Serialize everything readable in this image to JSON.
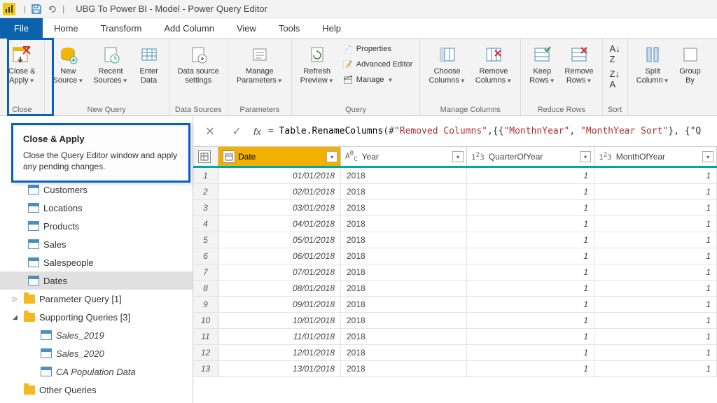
{
  "title": "UBG To Power BI - Model - Power Query Editor",
  "menus": [
    "File",
    "Home",
    "Transform",
    "Add Column",
    "View",
    "Tools",
    "Help"
  ],
  "ribbon": {
    "close": {
      "label": "Close &\nApply",
      "group": "Close"
    },
    "new_query": {
      "new_source": "New\nSource",
      "recent": "Recent\nSources",
      "enter": "Enter\nData",
      "group": "New Query"
    },
    "data_sources": {
      "settings": "Data source\nsettings",
      "group": "Data Sources"
    },
    "parameters": {
      "manage": "Manage\nParameters",
      "group": "Parameters"
    },
    "query": {
      "refresh": "Refresh\nPreview",
      "properties": "Properties",
      "advanced": "Advanced Editor",
      "manage": "Manage",
      "group": "Query"
    },
    "manage_cols": {
      "choose": "Choose\nColumns",
      "remove": "Remove\nColumns",
      "group": "Manage Columns"
    },
    "reduce_rows": {
      "keep": "Keep\nRows",
      "remove": "Remove\nRows",
      "group": "Reduce Rows"
    },
    "sort": {
      "group": "Sort"
    },
    "transform": {
      "split": "Split\nColumn",
      "group": "Group\nBy"
    }
  },
  "tooltip": {
    "title": "Close & Apply",
    "body": "Close the Query Editor window and apply any pending changes."
  },
  "queries": {
    "tables": [
      "Customers",
      "Locations",
      "Products",
      "Sales",
      "Salespeople",
      "Dates"
    ],
    "selected": "Dates",
    "folders": [
      {
        "name": "Parameter Query [1]",
        "open": false
      },
      {
        "name": "Supporting Queries [3]",
        "open": true,
        "items": [
          "Sales_2019",
          "Sales_2020",
          "CA Population Data"
        ]
      }
    ],
    "other": "Other Queries"
  },
  "formula": {
    "prefix": "= ",
    "fn": "Table.RenameColumns",
    "args_pre": "(#",
    "str1": "\"Removed Columns\"",
    "mid": ",{{",
    "str2": "\"MonthnYear\"",
    "sep": ", ",
    "str3": "\"MonthYear Sort\"",
    "tail": "}, {\"Q"
  },
  "grid": {
    "columns": [
      {
        "name": "Date",
        "type": "date",
        "cls": "col-date",
        "selected": true
      },
      {
        "name": "Year",
        "type": "ABC",
        "cls": "col-year"
      },
      {
        "name": "QuarterOfYear",
        "type": "123",
        "cls": "col-qtr"
      },
      {
        "name": "MonthOfYear",
        "type": "123",
        "cls": "col-mth"
      }
    ],
    "rows": [
      {
        "n": 1,
        "date": "01/01/2018",
        "year": "2018",
        "q": "1",
        "m": "1"
      },
      {
        "n": 2,
        "date": "02/01/2018",
        "year": "2018",
        "q": "1",
        "m": "1"
      },
      {
        "n": 3,
        "date": "03/01/2018",
        "year": "2018",
        "q": "1",
        "m": "1"
      },
      {
        "n": 4,
        "date": "04/01/2018",
        "year": "2018",
        "q": "1",
        "m": "1"
      },
      {
        "n": 5,
        "date": "05/01/2018",
        "year": "2018",
        "q": "1",
        "m": "1"
      },
      {
        "n": 6,
        "date": "06/01/2018",
        "year": "2018",
        "q": "1",
        "m": "1"
      },
      {
        "n": 7,
        "date": "07/01/2018",
        "year": "2018",
        "q": "1",
        "m": "1"
      },
      {
        "n": 8,
        "date": "08/01/2018",
        "year": "2018",
        "q": "1",
        "m": "1"
      },
      {
        "n": 9,
        "date": "09/01/2018",
        "year": "2018",
        "q": "1",
        "m": "1"
      },
      {
        "n": 10,
        "date": "10/01/2018",
        "year": "2018",
        "q": "1",
        "m": "1"
      },
      {
        "n": 11,
        "date": "11/01/2018",
        "year": "2018",
        "q": "1",
        "m": "1"
      },
      {
        "n": 12,
        "date": "12/01/2018",
        "year": "2018",
        "q": "1",
        "m": "1"
      },
      {
        "n": 13,
        "date": "13/01/2018",
        "year": "2018",
        "q": "1",
        "m": "1"
      }
    ]
  }
}
